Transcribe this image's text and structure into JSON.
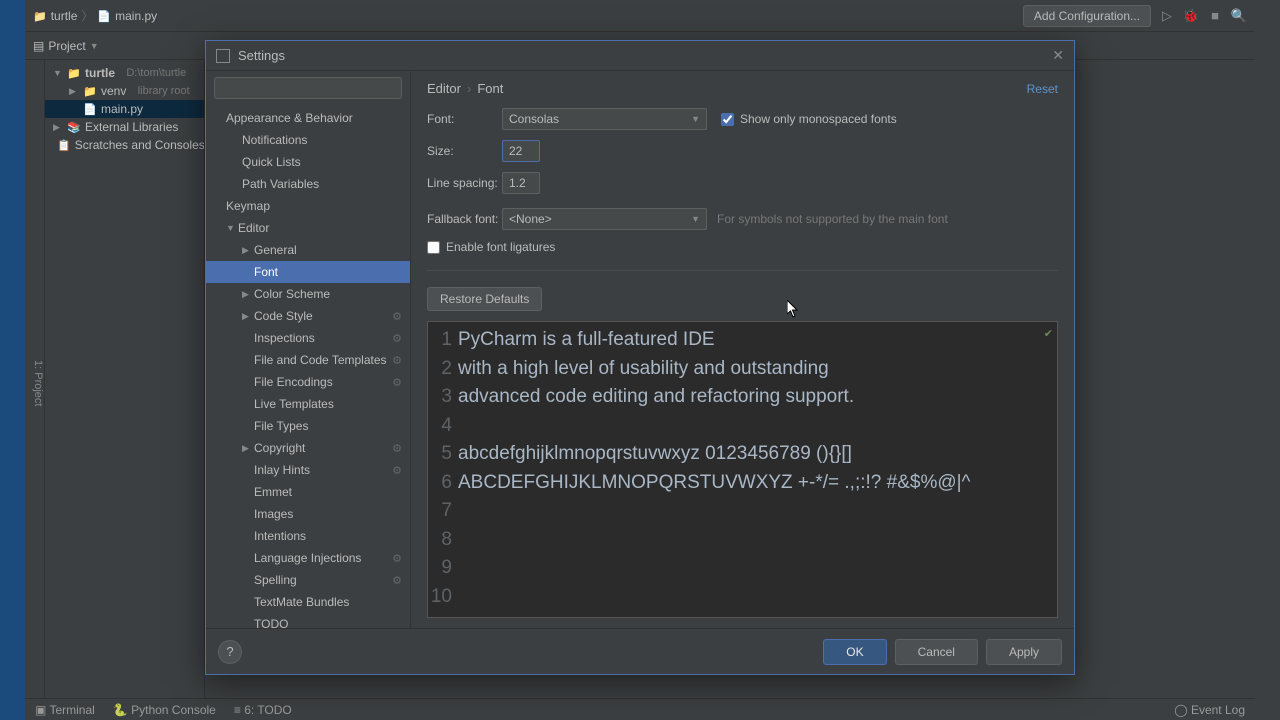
{
  "titlebar": {
    "breadcrumb_root": "turtle",
    "breadcrumb_file": "main.py",
    "add_configuration": "Add Configuration..."
  },
  "toolbar": {
    "project_label": "Project"
  },
  "tree": {
    "root": "turtle",
    "root_path": "D:\\tom\\turtle",
    "venv": "venv",
    "venv_sub": "library root",
    "main": "main.py",
    "ext_lib": "External Libraries",
    "scratches": "Scratches and Consoles"
  },
  "left_tab": "1: Project",
  "settings": {
    "title": "Settings",
    "search_placeholder": "",
    "breadcrumb1": "Editor",
    "breadcrumb2": "Font",
    "reset": "Reset",
    "nav": {
      "appearance": "Appearance & Behavior",
      "notifications": "Notifications",
      "quick_lists": "Quick Lists",
      "path_vars": "Path Variables",
      "keymap": "Keymap",
      "editor": "Editor",
      "general": "General",
      "font": "Font",
      "color_scheme": "Color Scheme",
      "code_style": "Code Style",
      "inspections": "Inspections",
      "file_templates": "File and Code Templates",
      "file_encodings": "File Encodings",
      "live_templates": "Live Templates",
      "file_types": "File Types",
      "copyright": "Copyright",
      "inlay_hints": "Inlay Hints",
      "emmet": "Emmet",
      "images": "Images",
      "intentions": "Intentions",
      "lang_inj": "Language Injections",
      "spelling": "Spelling",
      "textmate": "TextMate Bundles",
      "todo": "TODO"
    },
    "form": {
      "font_label": "Font:",
      "font_value": "Consolas",
      "mono_label": "Show only monospaced fonts",
      "size_label": "Size:",
      "size_value": "22",
      "linespacing_label": "Line spacing:",
      "linespacing_value": "1.2",
      "fallback_label": "Fallback font:",
      "fallback_value": "<None>",
      "fallback_hint": "For symbols not supported by the main font",
      "ligatures_label": "Enable font ligatures",
      "restore": "Restore Defaults"
    },
    "preview_lines": [
      "PyCharm is a full-featured IDE",
      "with a high level of usability and outstanding",
      "advanced code editing and refactoring support.",
      "",
      "abcdefghijklmnopqrstuvwxyz 0123456789 (){}[]",
      "ABCDEFGHIJKLMNOPQRSTUVWXYZ +-*/= .,;:!? #&$%@|^",
      "",
      "",
      "",
      ""
    ],
    "buttons": {
      "ok": "OK",
      "cancel": "Cancel",
      "apply": "Apply",
      "help": "?"
    }
  },
  "statusbar": {
    "terminal": "Terminal",
    "python_console": "Python Console",
    "todo": "6: TODO",
    "event_log": "Event Log"
  }
}
